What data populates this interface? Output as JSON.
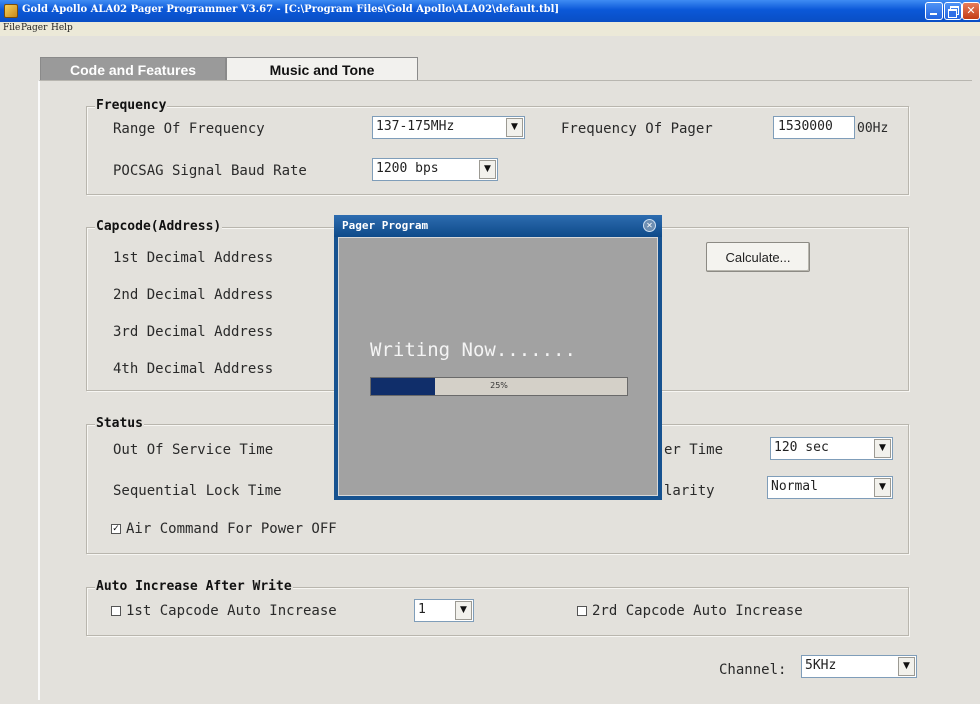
{
  "window": {
    "title": "Gold Apollo ALA02 Pager Programmer V3.67 - [C:\\Program Files\\Gold Apollo\\ALA02\\default.tbl]"
  },
  "menu": [
    "File",
    "Pager",
    "Help"
  ],
  "tabs": [
    {
      "label": "Code and Features",
      "active": true
    },
    {
      "label": "Music and Tone",
      "active": false
    }
  ],
  "frequency": {
    "legend": "Frequency",
    "range_label": "Range Of Frequency",
    "range_value": "137-175MHz",
    "pager_freq_label": "Frequency Of Pager",
    "pager_freq_value": "1530000",
    "pager_freq_unit": "00Hz",
    "baud_label": "POCSAG Signal Baud Rate",
    "baud_value": "1200 bps"
  },
  "capcode": {
    "legend": "Capcode(Address)",
    "addresses": [
      "1st Decimal Address",
      "2nd Decimal Address",
      "3rd Decimal Address",
      "4th Decimal Address"
    ],
    "calculate_label": "Calculate..."
  },
  "status": {
    "legend": "Status",
    "out_of_service_label": "Out Of Service Time",
    "sequential_lock_label": "Sequential Lock Time",
    "timer_label_partial": "er Time",
    "timer_value": "120 sec",
    "polarity_label_partial": "larity",
    "polarity_value": "Normal",
    "air_command_label": "Air Command For Power OFF",
    "air_command_checked": true
  },
  "auto_increase": {
    "legend": "Auto Increase After Write",
    "first_label": "1st Capcode Auto Increase",
    "first_checked": false,
    "first_value": "1",
    "second_label": "2rd Capcode Auto Increase",
    "second_checked": false
  },
  "channel": {
    "label": "Channel:",
    "value": "5KHz"
  },
  "dialog": {
    "title": "Pager Program",
    "message": "Writing Now.......",
    "progress_percent": 25,
    "progress_text": "25%"
  }
}
